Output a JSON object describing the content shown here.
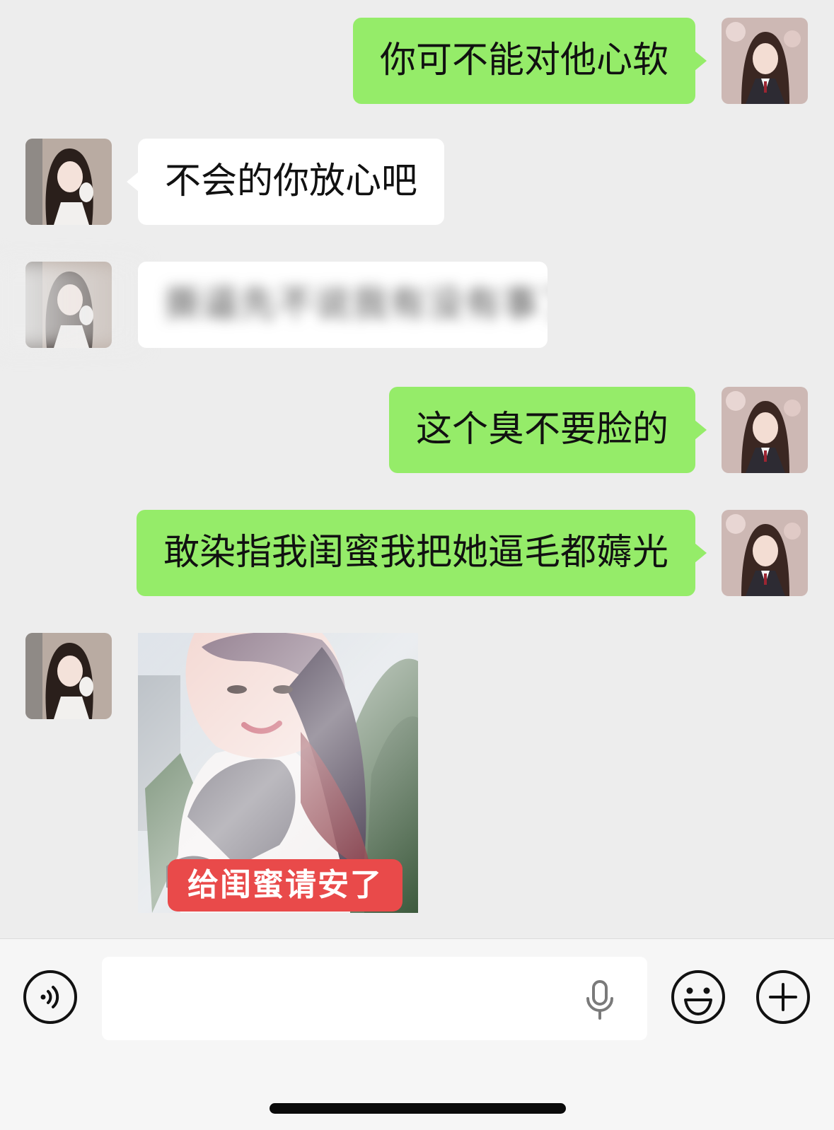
{
  "messages": [
    {
      "side": "me",
      "text": "你可不能对他心软"
    },
    {
      "side": "them",
      "text": "不会的你放心吧"
    },
    {
      "side": "them",
      "text": "撕逼先不说我有没有事了",
      "blurred": true
    },
    {
      "side": "me",
      "text": "这个臭不要脸的"
    },
    {
      "side": "me",
      "text": "敢染指我闺蜜我把她逼毛都薅光"
    },
    {
      "side": "them",
      "type": "sticker",
      "caption": "给闺蜜请安了"
    }
  ],
  "input": {
    "placeholder": "",
    "value": ""
  },
  "icons": {
    "voice": "voice-icon",
    "mic": "mic-icon",
    "emoji": "emoji-icon",
    "plus": "plus-icon"
  },
  "colors": {
    "background": "#ededed",
    "my_bubble": "#95ec69",
    "their_bubble": "#ffffff",
    "sticker_caption": "#e94a4a"
  }
}
